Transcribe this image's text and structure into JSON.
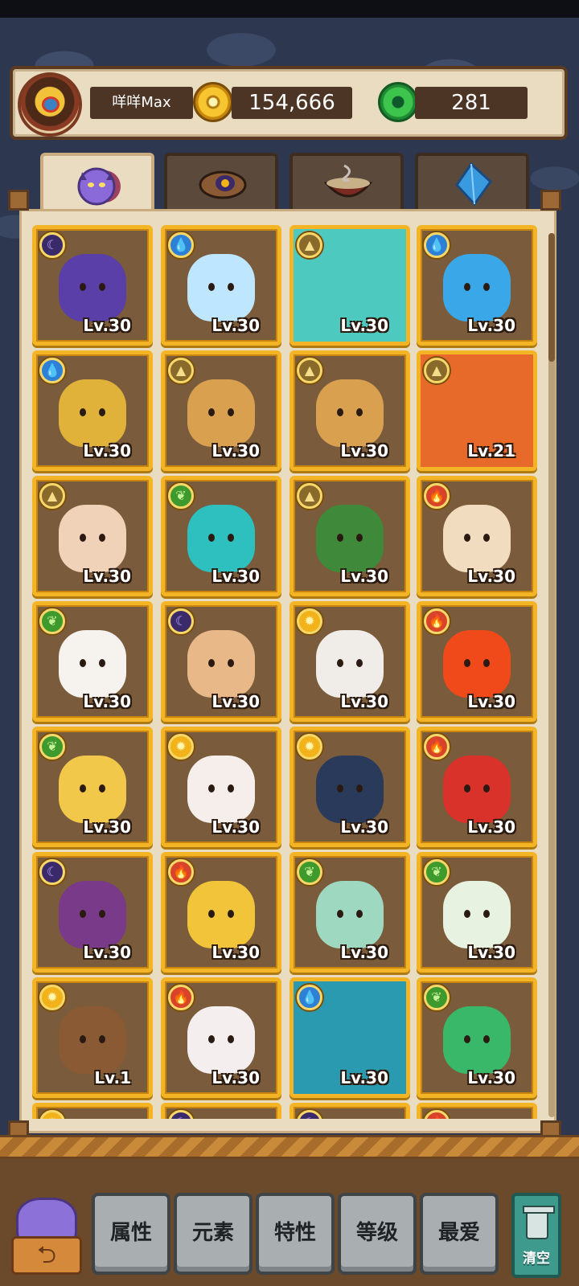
{
  "player": {
    "name": "咩咩Max",
    "coins": "154,666",
    "gems": "281"
  },
  "tabs": [
    {
      "name": "pets",
      "icon": "purple-monster-icon",
      "active": true
    },
    {
      "name": "items",
      "icon": "feather-scroll-icon",
      "active": false
    },
    {
      "name": "food",
      "icon": "noodle-bowl-icon",
      "active": false
    },
    {
      "name": "crystals",
      "icon": "blue-crystal-icon",
      "active": false
    }
  ],
  "cards": [
    {
      "element": "moon",
      "level": "Lv.30",
      "icon": "purple-cat-icon",
      "color": "#5a3fa8"
    },
    {
      "element": "water",
      "level": "Lv.30",
      "icon": "ice-fish-icon",
      "color": "#bfe6ff"
    },
    {
      "element": "earth",
      "level": "Lv.30",
      "icon": "teal-hair-girl-icon",
      "color": "#4ec9c0",
      "portrait": true
    },
    {
      "element": "water",
      "level": "Lv.30",
      "icon": "blue-dragon-icon",
      "color": "#3aa8e8"
    },
    {
      "element": "water",
      "level": "Lv.30",
      "icon": "golden-scale-icon",
      "color": "#e0b23a"
    },
    {
      "element": "earth",
      "level": "Lv.30",
      "icon": "leo-star-icon",
      "color": "#d9a050"
    },
    {
      "element": "earth",
      "level": "Lv.30",
      "icon": "monkey-charm-icon",
      "color": "#d9a050"
    },
    {
      "element": "earth",
      "level": "Lv.21",
      "icon": "fire-king-icon",
      "color": "#e86a2a",
      "portrait": true
    },
    {
      "element": "earth",
      "level": "Lv.30",
      "icon": "ox-box-icon",
      "color": "#f0d2b8"
    },
    {
      "element": "leaf",
      "level": "Lv.30",
      "icon": "teal-blob-icon",
      "color": "#2ebfbf"
    },
    {
      "element": "earth",
      "level": "Lv.30",
      "icon": "green-rock-icon",
      "color": "#3f8a3a"
    },
    {
      "element": "fire",
      "level": "Lv.30",
      "icon": "drum-baby-icon",
      "color": "#f2dcc0"
    },
    {
      "element": "leaf",
      "level": "Lv.30",
      "icon": "white-cat-leaf-icon",
      "color": "#f6f2ee"
    },
    {
      "element": "moon",
      "level": "Lv.30",
      "icon": "swordsman-icon",
      "color": "#e8b888"
    },
    {
      "element": "sun",
      "level": "Lv.30",
      "icon": "mouse-box-icon",
      "color": "#f0ece8"
    },
    {
      "element": "fire",
      "level": "Lv.30",
      "icon": "fire-spirit-icon",
      "color": "#f04a1a"
    },
    {
      "element": "leaf",
      "level": "Lv.30",
      "icon": "wheat-chick-icon",
      "color": "#f2c84a"
    },
    {
      "element": "sun",
      "level": "Lv.30",
      "icon": "ghost-bull-icon",
      "color": "#f6eeea"
    },
    {
      "element": "sun",
      "level": "Lv.30",
      "icon": "warrior-icon",
      "color": "#2a3a5a"
    },
    {
      "element": "fire",
      "level": "Lv.30",
      "icon": "red-yarn-icon",
      "color": "#d8322a"
    },
    {
      "element": "moon",
      "level": "Lv.30",
      "icon": "eggplant-icon",
      "color": "#7a3a8a"
    },
    {
      "element": "fire",
      "level": "Lv.30",
      "icon": "gold-ingot-icon",
      "color": "#f2c43a"
    },
    {
      "element": "leaf",
      "level": "Lv.30",
      "icon": "cloud-girl-icon",
      "color": "#9ed8c0"
    },
    {
      "element": "leaf",
      "level": "Lv.30",
      "icon": "lily-baby-icon",
      "color": "#e8f2e0"
    },
    {
      "element": "sun",
      "level": "Lv.1",
      "icon": "coconut-icon",
      "color": "#8a5a34"
    },
    {
      "element": "fire",
      "level": "Lv.30",
      "icon": "gift-box-icon",
      "color": "#f4eeee"
    },
    {
      "element": "water",
      "level": "Lv.30",
      "icon": "mermaid-icon",
      "color": "#2a9ab0",
      "portrait": true
    },
    {
      "element": "leaf",
      "level": "Lv.30",
      "icon": "jade-gourd-icon",
      "color": "#3ab86a"
    },
    {
      "element": "sun",
      "level": "",
      "icon": "partial-card-icon",
      "color": "#7a5b3b"
    },
    {
      "element": "moon",
      "level": "",
      "icon": "partial-card-icon",
      "color": "#7a5b3b"
    },
    {
      "element": "moon",
      "level": "",
      "icon": "partial-card-icon",
      "color": "#7a5b3b"
    },
    {
      "element": "fire",
      "level": "",
      "icon": "partial-card-icon",
      "color": "#7a5b3b"
    }
  ],
  "element_glyphs": {
    "moon": "☾",
    "water": "💧",
    "earth": "▲",
    "fire": "🔥",
    "leaf": "❦",
    "sun": "✹"
  },
  "sort_buttons": [
    "属性",
    "元素",
    "特性",
    "等级",
    "最爱"
  ],
  "clear_label": "清空",
  "back_icon": "return-arrow-icon"
}
